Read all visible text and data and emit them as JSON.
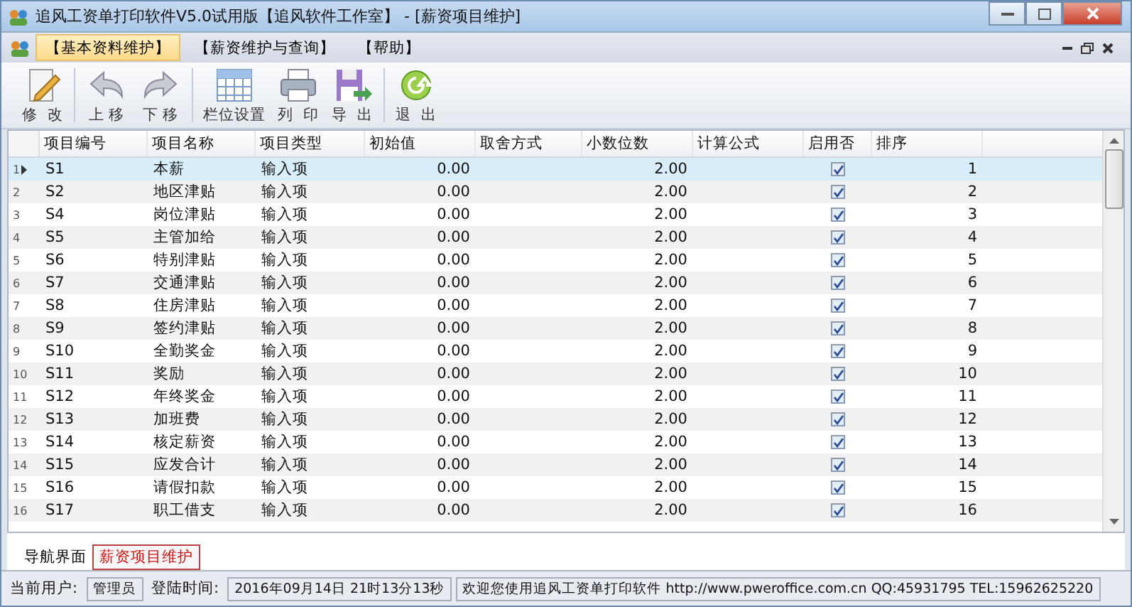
{
  "window": {
    "title": "追风工资单打印软件V5.0试用版【追风软件工作室】 - [薪资项目维护]"
  },
  "menu": [
    {
      "label": "【基本资料维护】",
      "selected": true
    },
    {
      "label": "【薪资维护与查询】",
      "selected": false
    },
    {
      "label": "【帮助】",
      "selected": false
    }
  ],
  "toolbar": [
    {
      "kind": "edit",
      "label": "修  改"
    },
    {
      "kind": "up",
      "label": "上 移"
    },
    {
      "kind": "down",
      "label": "下 移"
    },
    {
      "kind": "columns",
      "label": "栏位设置"
    },
    {
      "kind": "print",
      "label": "列  印"
    },
    {
      "kind": "export",
      "label": "导  出"
    },
    {
      "kind": "exit",
      "label": "退  出"
    }
  ],
  "table": {
    "columns": [
      "项目编号",
      "项目名称",
      "项目类型",
      "初始值",
      "取舍方式",
      "小数位数",
      "计算公式",
      "启用否",
      "排序"
    ],
    "rows": [
      {
        "row_number": "1",
        "selected": true,
        "code": "S1",
        "name": "本薪",
        "type": "输入项",
        "initial": "0.00",
        "decimals": "2.00",
        "enabled": true,
        "order": "1"
      },
      {
        "row_number": "2",
        "selected": false,
        "code": "S2",
        "name": "地区津贴",
        "type": "输入项",
        "initial": "0.00",
        "decimals": "2.00",
        "enabled": true,
        "order": "2"
      },
      {
        "row_number": "3",
        "selected": false,
        "code": "S4",
        "name": "岗位津贴",
        "type": "输入项",
        "initial": "0.00",
        "decimals": "2.00",
        "enabled": true,
        "order": "3"
      },
      {
        "row_number": "4",
        "selected": false,
        "code": "S5",
        "name": "主管加给",
        "type": "输入项",
        "initial": "0.00",
        "decimals": "2.00",
        "enabled": true,
        "order": "4"
      },
      {
        "row_number": "5",
        "selected": false,
        "code": "S6",
        "name": "特别津贴",
        "type": "输入项",
        "initial": "0.00",
        "decimals": "2.00",
        "enabled": true,
        "order": "5"
      },
      {
        "row_number": "6",
        "selected": false,
        "code": "S7",
        "name": "交通津贴",
        "type": "输入项",
        "initial": "0.00",
        "decimals": "2.00",
        "enabled": true,
        "order": "6"
      },
      {
        "row_number": "7",
        "selected": false,
        "code": "S8",
        "name": "住房津贴",
        "type": "输入项",
        "initial": "0.00",
        "decimals": "2.00",
        "enabled": true,
        "order": "7"
      },
      {
        "row_number": "8",
        "selected": false,
        "code": "S9",
        "name": "签约津贴",
        "type": "输入项",
        "initial": "0.00",
        "decimals": "2.00",
        "enabled": true,
        "order": "8"
      },
      {
        "row_number": "9",
        "selected": false,
        "code": "S10",
        "name": "全勤奖金",
        "type": "输入项",
        "initial": "0.00",
        "decimals": "2.00",
        "enabled": true,
        "order": "9"
      },
      {
        "row_number": "10",
        "selected": false,
        "code": "S11",
        "name": "奖励",
        "type": "输入项",
        "initial": "0.00",
        "decimals": "2.00",
        "enabled": true,
        "order": "10"
      },
      {
        "row_number": "11",
        "selected": false,
        "code": "S12",
        "name": "年终奖金",
        "type": "输入项",
        "initial": "0.00",
        "decimals": "2.00",
        "enabled": true,
        "order": "11"
      },
      {
        "row_number": "12",
        "selected": false,
        "code": "S13",
        "name": "加班费",
        "type": "输入项",
        "initial": "0.00",
        "decimals": "2.00",
        "enabled": true,
        "order": "12"
      },
      {
        "row_number": "13",
        "selected": false,
        "code": "S14",
        "name": "核定薪资",
        "type": "输入项",
        "initial": "0.00",
        "decimals": "2.00",
        "enabled": true,
        "order": "13"
      },
      {
        "row_number": "14",
        "selected": false,
        "code": "S15",
        "name": "应发合计",
        "type": "输入项",
        "initial": "0.00",
        "decimals": "2.00",
        "enabled": true,
        "order": "14"
      },
      {
        "row_number": "15",
        "selected": false,
        "code": "S16",
        "name": "请假扣款",
        "type": "输入项",
        "initial": "0.00",
        "decimals": "2.00",
        "enabled": true,
        "order": "15"
      },
      {
        "row_number": "16",
        "selected": false,
        "code": "S17",
        "name": "职工借支",
        "type": "输入项",
        "initial": "0.00",
        "decimals": "2.00",
        "enabled": true,
        "order": "16"
      }
    ]
  },
  "bottom_tabs": [
    {
      "label": "导航界面",
      "selected": false
    },
    {
      "label": "薪资项目维护",
      "selected": true
    }
  ],
  "status_bar": [
    {
      "kind": "label",
      "text": "当前用户:"
    },
    {
      "kind": "value",
      "text": "管理员"
    },
    {
      "kind": "label",
      "text": "登陆时间:"
    },
    {
      "kind": "value",
      "text": "2016年09月14日 21时13分13秒"
    },
    {
      "kind": "value",
      "text": "欢迎您使用追风工资单打印软件 http://www.pweroffice.com.cn QQ:45931795 TEL:15962625220"
    }
  ]
}
